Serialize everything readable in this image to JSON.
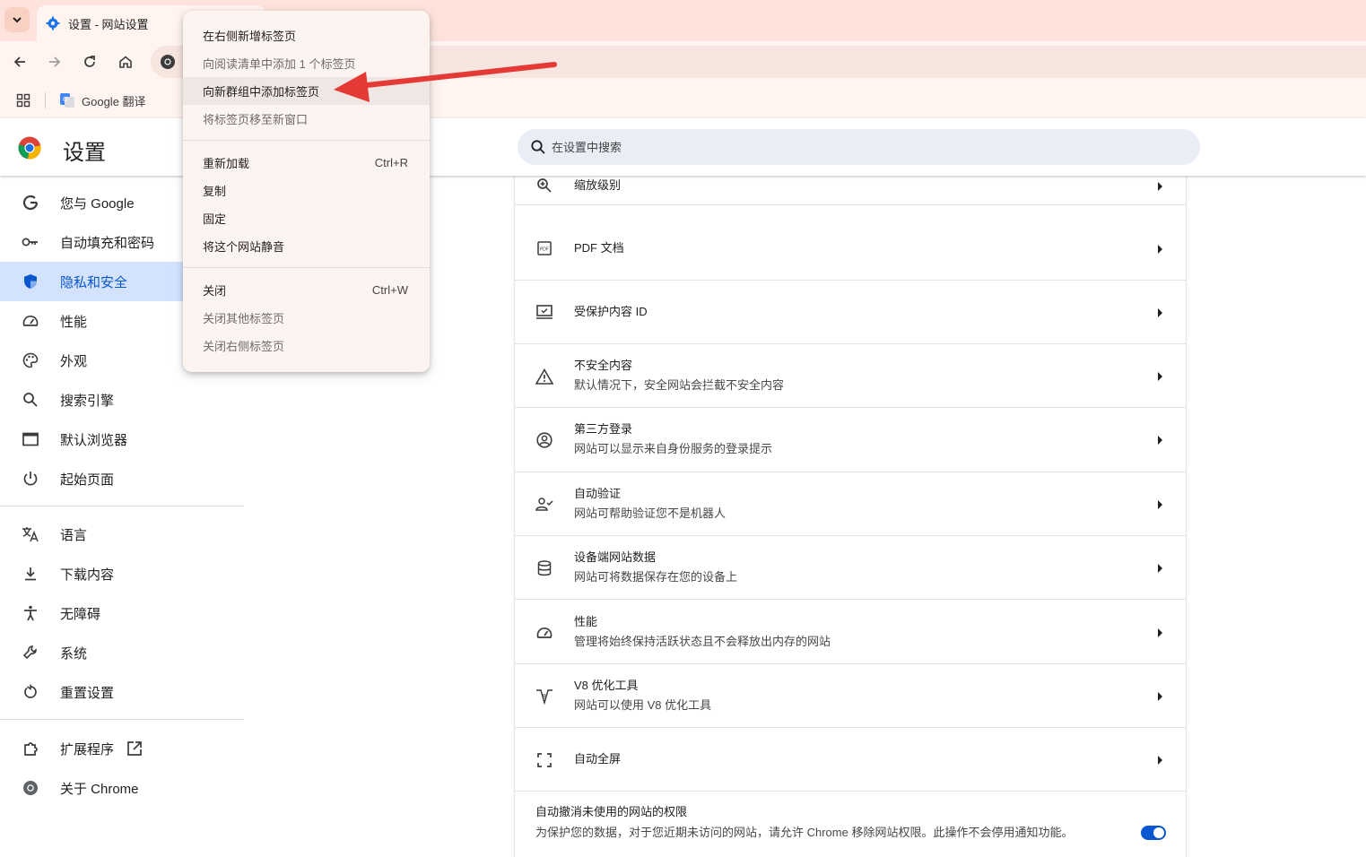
{
  "tab": {
    "title": "设置 - 网站设置"
  },
  "bookmarks": {
    "items": [
      {
        "label": "Google 翻译"
      }
    ]
  },
  "settings": {
    "title": "设置",
    "search_placeholder": "在设置中搜索"
  },
  "sidebar": {
    "items": [
      {
        "label": "您与 Google",
        "icon": "google-g-icon"
      },
      {
        "label": "自动填充和密码",
        "icon": "key-icon"
      },
      {
        "label": "隐私和安全",
        "icon": "shield-icon",
        "active": true
      },
      {
        "label": "性能",
        "icon": "speedometer-icon"
      },
      {
        "label": "外观",
        "icon": "palette-icon"
      },
      {
        "label": "搜索引擎",
        "icon": "search-icon"
      },
      {
        "label": "默认浏览器",
        "icon": "browser-window-icon"
      },
      {
        "label": "起始页面",
        "icon": "power-icon"
      },
      {
        "label": "语言",
        "icon": "translate-icon"
      },
      {
        "label": "下载内容",
        "icon": "download-icon"
      },
      {
        "label": "无障碍",
        "icon": "accessibility-icon"
      },
      {
        "label": "系统",
        "icon": "wrench-icon"
      },
      {
        "label": "重置设置",
        "icon": "reset-icon"
      },
      {
        "label": "扩展程序",
        "icon": "puzzle-icon"
      },
      {
        "label": "关于 Chrome",
        "icon": "chrome-icon"
      }
    ]
  },
  "content": {
    "rows": [
      {
        "title": "缩放级别",
        "desc": "",
        "icon": "zoom-in-icon"
      },
      {
        "title": "PDF 文档",
        "desc": "",
        "icon": "pdf-icon"
      },
      {
        "title": "受保护内容 ID",
        "desc": "",
        "icon": "protected-content-icon"
      },
      {
        "title": "不安全内容",
        "desc": "默认情况下，安全网站会拦截不安全内容",
        "icon": "warning-icon"
      },
      {
        "title": "第三方登录",
        "desc": "网站可以显示来自身份服务的登录提示",
        "icon": "account-circle-icon"
      },
      {
        "title": "自动验证",
        "desc": "网站可帮助验证您不是机器人",
        "icon": "person-check-icon"
      },
      {
        "title": "设备端网站数据",
        "desc": "网站可将数据保存在您的设备上",
        "icon": "database-icon"
      },
      {
        "title": "性能",
        "desc": "管理将始终保持活跃状态且不会释放出内存的网站",
        "icon": "speedometer-icon"
      },
      {
        "title": "V8 优化工具",
        "desc": "网站可以使用 V8 优化工具",
        "icon": "v8-icon"
      },
      {
        "title": "自动全屏",
        "desc": "",
        "icon": "fullscreen-icon"
      }
    ],
    "permissions": {
      "title": "自动撤消未使用的网站的权限",
      "desc": "为保护您的数据，对于您近期未访问的网站，请允许 Chrome 移除网站权限。此操作不会停用通知功能。",
      "toggle_on": true
    }
  },
  "context_menu": {
    "groups": [
      [
        {
          "label": "在右侧新增标签页",
          "enabled": true
        },
        {
          "label": "向阅读清单中添加 1 个标签页",
          "enabled": false
        },
        {
          "label": "向新群组中添加标签页",
          "enabled": true,
          "highlighted": true
        },
        {
          "label": "将标签页移至新窗口",
          "enabled": false
        }
      ],
      [
        {
          "label": "重新加载",
          "shortcut": "Ctrl+R",
          "enabled": true
        },
        {
          "label": "复制",
          "enabled": true
        },
        {
          "label": "固定",
          "enabled": true
        },
        {
          "label": "将这个网站静音",
          "enabled": true
        }
      ],
      [
        {
          "label": "关闭",
          "shortcut": "Ctrl+W",
          "enabled": true
        },
        {
          "label": "关闭其他标签页",
          "enabled": false
        },
        {
          "label": "关闭右侧标签页",
          "enabled": false
        }
      ]
    ]
  },
  "colors": {
    "accent": "#0b57d0",
    "active_nav_bg": "#d3e3fd",
    "tabstrip_bg": "#fde3db",
    "annotation_arrow": "#e53935"
  }
}
